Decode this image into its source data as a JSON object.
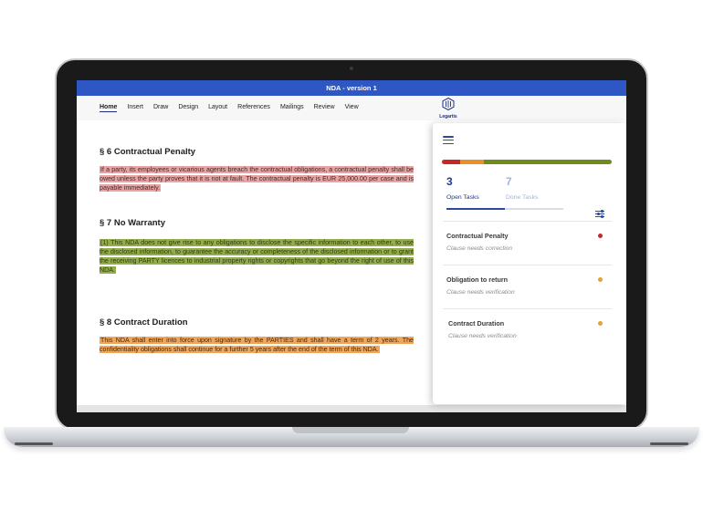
{
  "window": {
    "title": "NDA - version 1"
  },
  "ribbon": {
    "tabs": [
      "Home",
      "Insert",
      "Draw",
      "Design",
      "Layout",
      "References",
      "Mailings",
      "Review",
      "View"
    ],
    "active_tab": "Home"
  },
  "brand": {
    "name": "Legartis"
  },
  "document": {
    "sections": [
      {
        "title": "§ 6 Contractual Penalty",
        "text": "If a party, its employees or vicarious agents breach the contractual obligations, a contractual penalty shall be owed unless the party proves that it is not at fault. The contractual penalty is EUR 25,000.00 per case and is payable immediately.",
        "highlight": "#e9a3a3"
      },
      {
        "title": "§ 7 No Warranty",
        "text": "(1) This NDA does not give rise to any obligations to disclose the specific information to each other, to use the disclosed information, to guarantee the accuracy or completeness of the disclosed information or to grant the receiving PARTY licences to industrial property rights or copyrights that go beyond the right of use of this NDA.",
        "highlight": "#94ad4c"
      },
      {
        "title": "§ 8 Contract Duration",
        "text": "This NDA shall enter into force upon signature by the PARTIES and shall have a term of 2 years. The confidentiality obligations shall continue for a further 5 years after the end of the term of this NDA.",
        "highlight": "#f0a659"
      }
    ]
  },
  "panel": {
    "progress_segments": [
      {
        "status": "penalty",
        "color": "#c62828",
        "fraction": 0.11
      },
      {
        "status": "verification",
        "color": "#e8912a",
        "fraction": 0.14
      },
      {
        "status": "done",
        "color": "#6f8a1d",
        "fraction": 0.75
      }
    ],
    "open": {
      "count": "3",
      "label": "Open Tasks",
      "color": "#1e3a8a"
    },
    "done": {
      "count": "7",
      "label": "Done Tasks",
      "color": "#9db4dc"
    },
    "tasks": [
      {
        "title": "Contractual Penalty",
        "subtitle": "Clause needs correction",
        "dot_color": "#c62828"
      },
      {
        "title": "Obligation to return",
        "subtitle": "Clause needs verification",
        "dot_color": "#e8a03a"
      },
      {
        "title": "Contract Duration",
        "subtitle": "Clause needs verification",
        "dot_color": "#e8a03a"
      }
    ]
  },
  "colors": {
    "titlebar": "#2f57c3",
    "accent": "#2c4a9e"
  }
}
